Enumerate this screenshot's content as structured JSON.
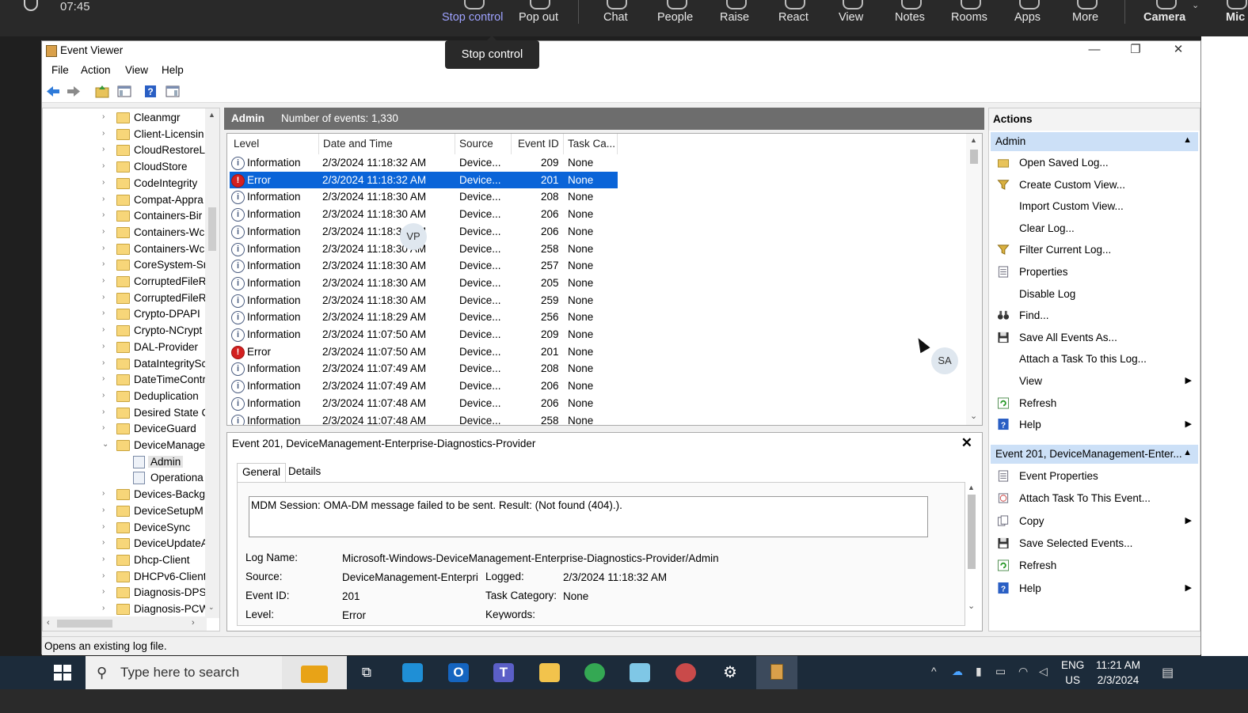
{
  "teams": {
    "time": "07:45",
    "buttons": [
      "Stop control",
      "Pop out",
      "Chat",
      "People",
      "Raise",
      "React",
      "View",
      "Notes",
      "Rooms",
      "Apps",
      "More",
      "Camera",
      "Mic"
    ],
    "tooltip": "Stop control"
  },
  "window": {
    "title": "Event Viewer",
    "menu": [
      "File",
      "Action",
      "View",
      "Help"
    ],
    "controls": {
      "minimize": "—",
      "restore": "❐",
      "close": "✕"
    }
  },
  "tree": {
    "items": [
      {
        "label": "Cleanmgr",
        "type": "folder"
      },
      {
        "label": "Client-Licensin",
        "type": "folder"
      },
      {
        "label": "CloudRestoreL",
        "type": "folder"
      },
      {
        "label": "CloudStore",
        "type": "folder"
      },
      {
        "label": "CodeIntegrity",
        "type": "folder"
      },
      {
        "label": "Compat-Appra",
        "type": "folder"
      },
      {
        "label": "Containers-Bir",
        "type": "folder"
      },
      {
        "label": "Containers-Wc",
        "type": "folder"
      },
      {
        "label": "Containers-Wc",
        "type": "folder"
      },
      {
        "label": "CoreSystem-Sr",
        "type": "folder"
      },
      {
        "label": "CorruptedFileR",
        "type": "folder"
      },
      {
        "label": "CorruptedFileR",
        "type": "folder"
      },
      {
        "label": "Crypto-DPAPI",
        "type": "folder"
      },
      {
        "label": "Crypto-NCrypt",
        "type": "folder"
      },
      {
        "label": "DAL-Provider",
        "type": "folder"
      },
      {
        "label": "DataIntegritySc",
        "type": "folder"
      },
      {
        "label": "DateTimeContr",
        "type": "folder"
      },
      {
        "label": "Deduplication",
        "type": "folder"
      },
      {
        "label": "Desired State C",
        "type": "folder"
      },
      {
        "label": "DeviceGuard",
        "type": "folder"
      },
      {
        "label": "DeviceManage",
        "type": "folder",
        "expanded": true
      },
      {
        "label": "Admin",
        "type": "log",
        "selected": true
      },
      {
        "label": "Operationa",
        "type": "log"
      },
      {
        "label": "Devices-Backg",
        "type": "folder"
      },
      {
        "label": "DeviceSetupM",
        "type": "folder"
      },
      {
        "label": "DeviceSync",
        "type": "folder"
      },
      {
        "label": "DeviceUpdateA",
        "type": "folder"
      },
      {
        "label": "Dhcp-Client",
        "type": "folder"
      },
      {
        "label": "DHCPv6-Client",
        "type": "folder"
      },
      {
        "label": "Diagnosis-DPS",
        "type": "folder"
      },
      {
        "label": "Diagnosis-PCW",
        "type": "folder"
      }
    ]
  },
  "list": {
    "header_name": "Admin",
    "header_count": "Number of events: 1,330",
    "columns": [
      "Level",
      "Date and Time",
      "Source",
      "Event ID",
      "Task Ca..."
    ],
    "rows": [
      {
        "level": "Information",
        "date": "2/3/2024 11:18:32 AM",
        "source": "Device...",
        "id": "209",
        "task": "None"
      },
      {
        "level": "Error",
        "date": "2/3/2024 11:18:32 AM",
        "source": "Device...",
        "id": "201",
        "task": "None",
        "selected": true
      },
      {
        "level": "Information",
        "date": "2/3/2024 11:18:30 AM",
        "source": "Device...",
        "id": "208",
        "task": "None"
      },
      {
        "level": "Information",
        "date": "2/3/2024 11:18:30 AM",
        "source": "Device...",
        "id": "206",
        "task": "None"
      },
      {
        "level": "Information",
        "date": "2/3/2024 11:18:30 AM",
        "source": "Device...",
        "id": "206",
        "task": "None"
      },
      {
        "level": "Information",
        "date": "2/3/2024 11:18:30 AM",
        "source": "Device...",
        "id": "258",
        "task": "None"
      },
      {
        "level": "Information",
        "date": "2/3/2024 11:18:30 AM",
        "source": "Device...",
        "id": "257",
        "task": "None"
      },
      {
        "level": "Information",
        "date": "2/3/2024 11:18:30 AM",
        "source": "Device...",
        "id": "205",
        "task": "None"
      },
      {
        "level": "Information",
        "date": "2/3/2024 11:18:30 AM",
        "source": "Device...",
        "id": "259",
        "task": "None"
      },
      {
        "level": "Information",
        "date": "2/3/2024 11:18:29 AM",
        "source": "Device...",
        "id": "256",
        "task": "None"
      },
      {
        "level": "Information",
        "date": "2/3/2024 11:07:50 AM",
        "source": "Device...",
        "id": "209",
        "task": "None"
      },
      {
        "level": "Error",
        "date": "2/3/2024 11:07:50 AM",
        "source": "Device...",
        "id": "201",
        "task": "None"
      },
      {
        "level": "Information",
        "date": "2/3/2024 11:07:49 AM",
        "source": "Device...",
        "id": "208",
        "task": "None"
      },
      {
        "level": "Information",
        "date": "2/3/2024 11:07:49 AM",
        "source": "Device...",
        "id": "206",
        "task": "None"
      },
      {
        "level": "Information",
        "date": "2/3/2024 11:07:48 AM",
        "source": "Device...",
        "id": "206",
        "task": "None"
      },
      {
        "level": "Information",
        "date": "2/3/2024 11:07:48 AM",
        "source": "Device...",
        "id": "258",
        "task": "None"
      }
    ]
  },
  "avatars": {
    "vp": "VP",
    "sa": "SA"
  },
  "detail": {
    "title": "Event 201, DeviceManagement-Enterprise-Diagnostics-Provider",
    "close": "✕",
    "tabs": [
      "General",
      "Details"
    ],
    "message": "MDM Session: OMA-DM message failed to be sent. Result: (Not found (404).).",
    "fields": {
      "log_name_label": "Log Name:",
      "log_name": "Microsoft-Windows-DeviceManagement-Enterprise-Diagnostics-Provider/Admin",
      "source_label": "Source:",
      "source": "DeviceManagement-Enterpri",
      "logged_label": "Logged:",
      "logged": "2/3/2024 11:18:32 AM",
      "event_id_label": "Event ID:",
      "event_id": "201",
      "task_label": "Task Category:",
      "task": "None",
      "level_label": "Level:",
      "level": "Error",
      "keywords_label": "Keywords:"
    }
  },
  "actions": {
    "title": "Actions",
    "section1": "Admin",
    "items1": [
      {
        "label": "Open Saved Log...",
        "icon": "folder-open-icon"
      },
      {
        "label": "Create Custom View...",
        "icon": "filter-icon"
      },
      {
        "label": "Import Custom View...",
        "icon": ""
      },
      {
        "label": "Clear Log...",
        "icon": ""
      },
      {
        "label": "Filter Current Log...",
        "icon": "filter-icon"
      },
      {
        "label": "Properties",
        "icon": "properties-icon"
      },
      {
        "label": "Disable Log",
        "icon": ""
      },
      {
        "label": "Find...",
        "icon": "binoculars-icon"
      },
      {
        "label": "Save All Events As...",
        "icon": "save-icon"
      },
      {
        "label": "Attach a Task To this Log...",
        "icon": ""
      },
      {
        "label": "View",
        "icon": "",
        "submenu": true
      },
      {
        "label": "Refresh",
        "icon": "refresh-icon"
      },
      {
        "label": "Help",
        "icon": "help-icon",
        "submenu": true
      }
    ],
    "section2": "Event 201, DeviceManagement-Enter...",
    "items2": [
      {
        "label": "Event Properties",
        "icon": "properties-icon"
      },
      {
        "label": "Attach Task To This Event...",
        "icon": "task-icon"
      },
      {
        "label": "Copy",
        "icon": "copy-icon",
        "submenu": true
      },
      {
        "label": "Save Selected Events...",
        "icon": "save-icon"
      },
      {
        "label": "Refresh",
        "icon": "refresh-icon"
      },
      {
        "label": "Help",
        "icon": "help-icon",
        "submenu": true
      }
    ]
  },
  "status": "Opens an existing log file.",
  "taskbar": {
    "search_placeholder": "Type here to search",
    "lang1": "ENG",
    "lang2": "US",
    "time": "11:21 AM",
    "date": "2/3/2024"
  }
}
